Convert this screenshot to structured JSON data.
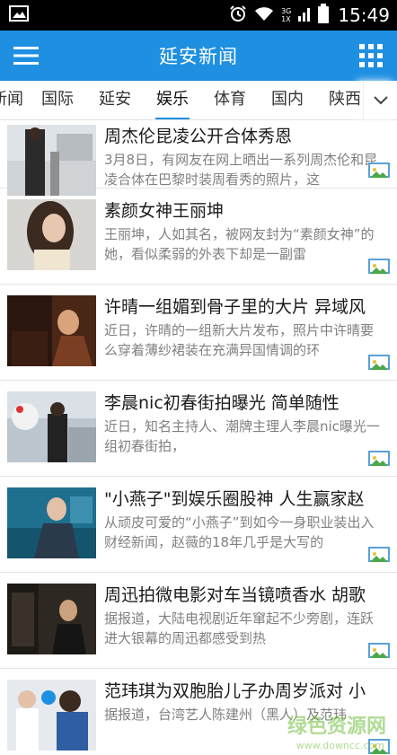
{
  "status": {
    "time": "15:49",
    "network_top": "3G",
    "network_bottom": "1X"
  },
  "app": {
    "title": "延安新闻"
  },
  "tabs": [
    "新闻",
    "国际",
    "延安",
    "娱乐",
    "体育",
    "国内",
    "陕西"
  ],
  "active_tab": "娱乐",
  "articles": [
    {
      "title": "周杰伦昆凌公开合体秀恩",
      "summary": "3月8日，有网友在网上晒出一系列周杰伦和昆凌合体在巴黎时装周看秀的照片，这"
    },
    {
      "title": "素颜女神王丽坤",
      "summary": "王丽坤，人如其名，被网友封为“素颜女神”的她，看似柔弱的外表下却是一副雷"
    },
    {
      "title": "许晴一组媚到骨子里的大片 异域风",
      "summary": "近日，许晴的一组新大片发布，照片中许晴要么穿着薄纱裙装在充满异国情调的环"
    },
    {
      "title": "李晨nic初春街拍曝光 简单随性",
      "summary": "近日，知名主持人、潮牌主理人李晨nic曝光一组初春街拍，"
    },
    {
      "title": "\"小燕子\"到娱乐圈股神 人生赢家赵",
      "summary": "从顽皮可爱的“小燕子”到如今一身职业装出入财经新闻，赵薇的18年几乎是大写的"
    },
    {
      "title": "周迅拍微电影对车当镜喷香水 胡歌",
      "summary": "据报道，大陆电视剧近年窜起不少旁剧，连跃进大银幕的周迅都感受到热"
    },
    {
      "title": "范玮琪为双胞胎儿子办周岁派对 小",
      "summary": "据报道，台湾艺人陈建州（黑人）及范玮"
    }
  ],
  "watermark": {
    "text": "绿色资源网",
    "sub": "www.downcc.com"
  },
  "colors": {
    "primary": "#1e8fe1",
    "status_bar": "#000000",
    "summary_text": "#808080"
  },
  "icons": {
    "menu": "hamburger-icon",
    "grid": "grid-icon",
    "more": "chevron-down-icon",
    "image_badge": "image-icon"
  }
}
